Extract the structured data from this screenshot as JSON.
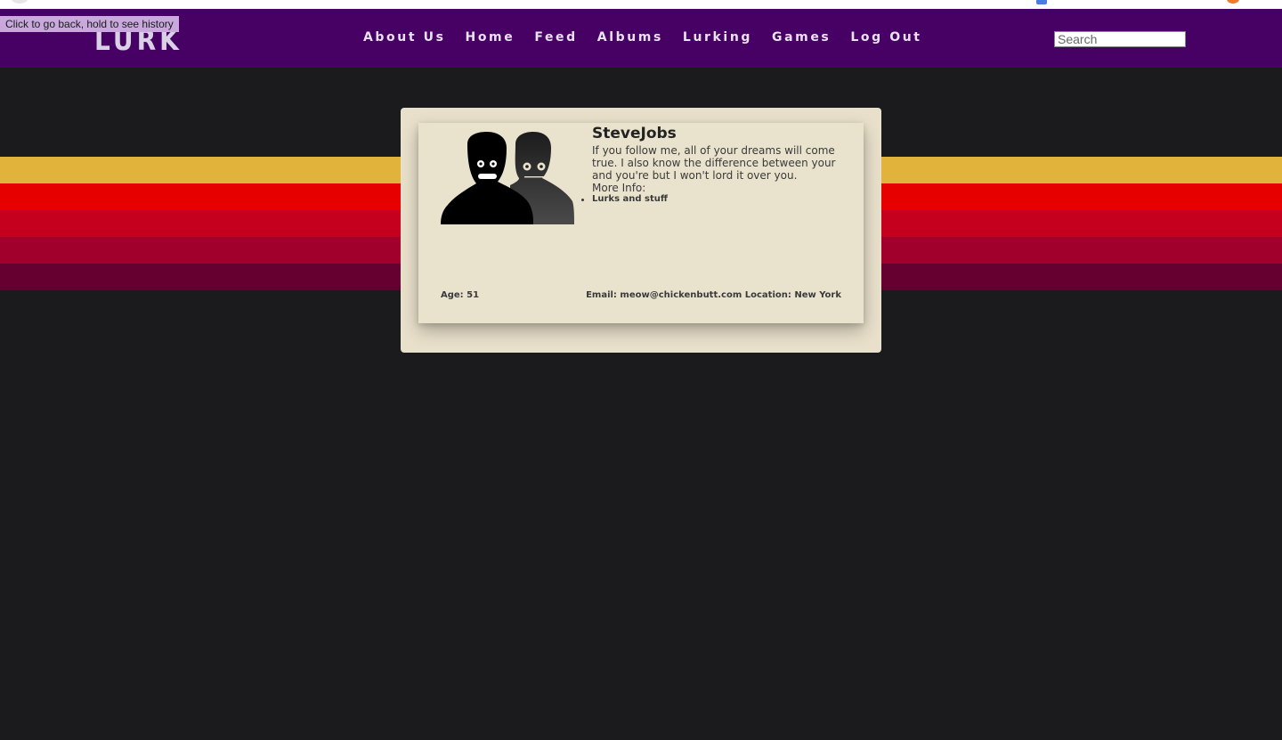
{
  "tooltip": "Click to go back, hold to see history",
  "logo": "LURK",
  "nav": {
    "items": [
      {
        "label": "About Us"
      },
      {
        "label": "Home"
      },
      {
        "label": "Feed"
      },
      {
        "label": "Albums"
      },
      {
        "label": "Lurking"
      },
      {
        "label": "Games"
      },
      {
        "label": "Log Out"
      }
    ]
  },
  "search": {
    "placeholder": "Search",
    "value": ""
  },
  "profile": {
    "username": "SteveJobs",
    "bio": "If you follow me, all of your dreams will come true. I also know the difference between your and you're but I won't lord it over you.",
    "more_info_label": "More Info:",
    "more_info_items": [
      "Lurks and stuff"
    ],
    "age": "Age: 51",
    "contact": "Email: meow@chickenbutt.com Location: New York",
    "avatar_icon": "people-silhouette-icon"
  },
  "colors": {
    "navbar": "#470164",
    "background": "#1b1b1d",
    "card": "#e9e2cd",
    "stripes": [
      "#e1b33a",
      "#e60000",
      "#c5001e",
      "#a2002c",
      "#650031"
    ]
  }
}
